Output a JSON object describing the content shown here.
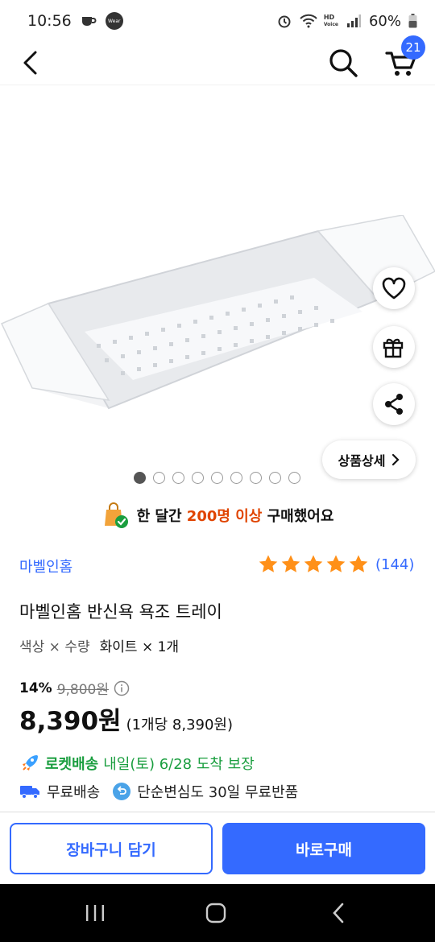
{
  "status_bar": {
    "time": "10:56",
    "battery": "60%",
    "wear_label": "Wear",
    "hd_label": "HD",
    "voice_label": "Voice"
  },
  "header": {
    "cart_count": "21"
  },
  "image": {
    "detail_label": "상품상세",
    "total_dots": 9,
    "active_dot": 0
  },
  "purchase_count": {
    "prefix": "한 달간",
    "highlight": "200명 이상",
    "suffix": "구매했어요"
  },
  "product": {
    "brand": "마벨인홈",
    "rating": 5,
    "review_count": "(144)",
    "title": "마벨인홈 반신욕 욕조 트레이",
    "option_label": "색상 × 수량",
    "option_value": "화이트 × 1개",
    "discount_rate": "14%",
    "original_price": "9,800원",
    "price": "8,390원",
    "unit_price": "(1개당 8,390원)"
  },
  "delivery": {
    "rocket_label": "로켓배송",
    "rocket_text": "내일(토) 6/28 도착 보장",
    "free_shipping": "무료배송",
    "free_return": "단순변심도 30일 무료반품"
  },
  "actions": {
    "add_to_cart": "장바구니 담기",
    "buy_now": "바로구매"
  },
  "colors": {
    "accent": "#346aff",
    "rocket_green": "#1a9e3f",
    "highlight_orange": "#e04400"
  },
  "icons": [
    "back-icon",
    "search-icon",
    "cart-icon",
    "heart-icon",
    "gift-icon",
    "share-icon",
    "chevron-right-icon",
    "shopping-bag-icon",
    "star-icon",
    "info-icon",
    "rocket-icon",
    "truck-icon",
    "return-icon"
  ]
}
